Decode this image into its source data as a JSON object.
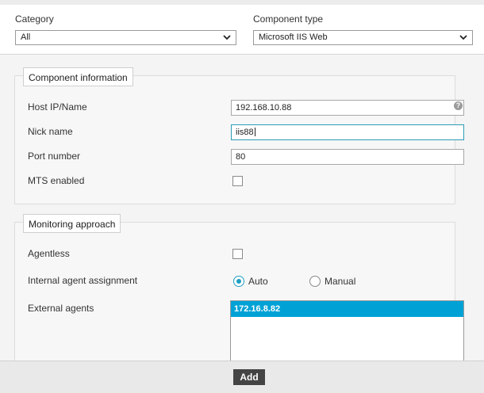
{
  "filters": {
    "category_label": "Category",
    "category_value": "All",
    "component_type_label": "Component type",
    "component_type_value": "Microsoft IIS Web"
  },
  "component_info": {
    "legend": "Component information",
    "host_label": "Host IP/Name",
    "host_value": "192.168.10.88",
    "help_glyph": "?",
    "nick_label": "Nick name",
    "nick_value": "iis88",
    "port_label": "Port number",
    "port_value": "80",
    "mts_label": "MTS enabled",
    "mts_checked": false
  },
  "monitoring": {
    "legend": "Monitoring approach",
    "agentless_label": "Agentless",
    "agentless_checked": false,
    "assignment_label": "Internal agent assignment",
    "assignment_options": [
      "Auto",
      "Manual"
    ],
    "assignment_selected": "Auto",
    "external_label": "External agents",
    "external_agents": [
      "172.16.8.82"
    ]
  },
  "footer": {
    "add_label": "Add"
  },
  "colors": {
    "accent": "#1e9ec1",
    "selection": "#00a2d6",
    "button": "#444444"
  }
}
